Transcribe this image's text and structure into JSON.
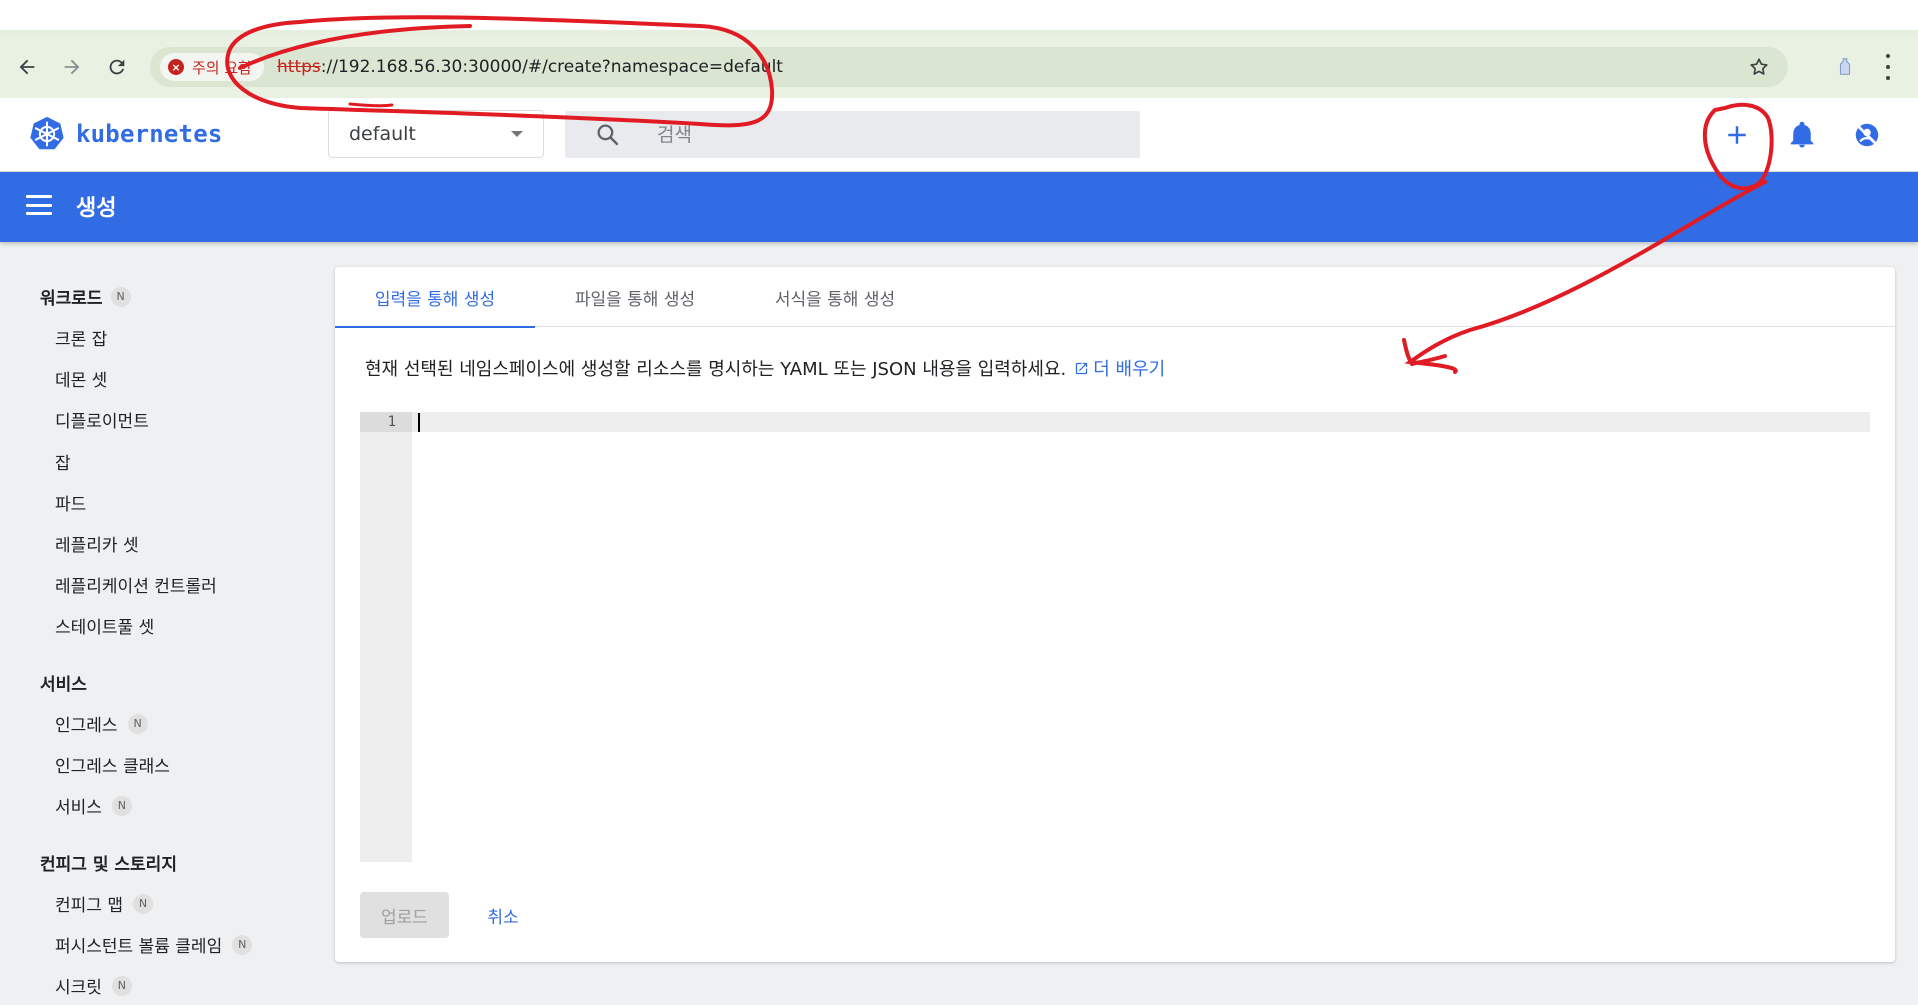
{
  "browser": {
    "security_text": "주의 요함",
    "url_scheme": "https",
    "url_rest": "://192.168.56.30:30000/#/create?namespace=default"
  },
  "header": {
    "brand": "kubernetes",
    "namespace": "default",
    "search_placeholder": "검색"
  },
  "titlebar": {
    "title": "생성"
  },
  "sidebar": {
    "sections": [
      {
        "label": "워크로드",
        "badge": "N"
      },
      {
        "label": "서비스"
      },
      {
        "label": "컨피그 및 스토리지"
      }
    ],
    "workloads": [
      "크론 잡",
      "데몬 셋",
      "디플로이먼트",
      "잡",
      "파드",
      "레플리카 셋",
      "레플리케이션 컨트롤러",
      "스테이트풀 셋"
    ],
    "services": [
      {
        "label": "인그레스",
        "badge": "N"
      },
      {
        "label": "인그레스 클래스"
      },
      {
        "label": "서비스",
        "badge": "N"
      }
    ],
    "config": [
      {
        "label": "컨피그 맵",
        "badge": "N"
      },
      {
        "label": "퍼시스턴트 볼륨 클레임",
        "badge": "N"
      },
      {
        "label": "시크릿",
        "badge": "N"
      }
    ]
  },
  "card": {
    "tabs": [
      "입력을 통해 생성",
      "파일을 통해 생성",
      "서식을 통해 생성"
    ],
    "description": "현재 선택된 네임스페이스에 생성할 리소스를 명시하는 YAML 또는 JSON 내용을 입력하세요.",
    "learn_more": "더 배우기",
    "line_number": "1",
    "upload_label": "업로드",
    "cancel_label": "취소"
  },
  "colors": {
    "brand_blue": "#326ce5",
    "annotation_red": "#e01b24",
    "error_red": "#c5221f"
  }
}
